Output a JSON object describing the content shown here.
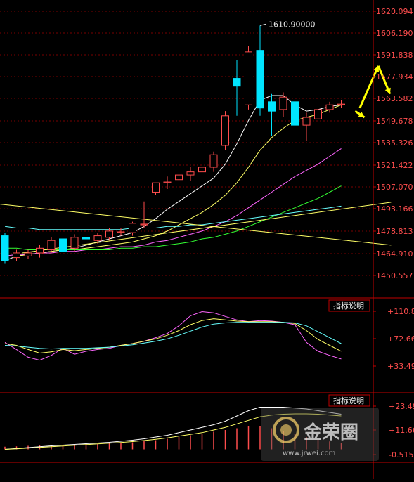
{
  "chart_data": [
    {
      "type": "candlestick",
      "ylim": [
        1442.0,
        1621.0
      ],
      "y_ticks": [
        "1620.094",
        "1606.190",
        "1591.838",
        "1577.934",
        "1563.582",
        "1549.678",
        "1535.326",
        "1521.422",
        "1507.070",
        "1493.166",
        "1478.813",
        "1464.910",
        "1450.557"
      ],
      "peak_label": "1610.90000",
      "peak_value": 1610.9,
      "candles": [
        {
          "o": 1476.0,
          "h": 1478.0,
          "l": 1458.0,
          "c": 1460.0
        },
        {
          "o": 1462.0,
          "h": 1467.0,
          "l": 1460.0,
          "c": 1465.0
        },
        {
          "o": 1463.0,
          "h": 1467.0,
          "l": 1461.0,
          "c": 1465.0
        },
        {
          "o": 1465.0,
          "h": 1470.0,
          "l": 1462.0,
          "c": 1468.0
        },
        {
          "o": 1467.0,
          "h": 1475.0,
          "l": 1465.0,
          "c": 1473.0
        },
        {
          "o": 1474.0,
          "h": 1485.0,
          "l": 1464.0,
          "c": 1466.0
        },
        {
          "o": 1468.0,
          "h": 1477.0,
          "l": 1466.0,
          "c": 1475.0
        },
        {
          "o": 1475.0,
          "h": 1477.0,
          "l": 1472.0,
          "c": 1474.0
        },
        {
          "o": 1473.0,
          "h": 1478.0,
          "l": 1471.0,
          "c": 1476.0
        },
        {
          "o": 1475.0,
          "h": 1481.0,
          "l": 1473.0,
          "c": 1479.0
        },
        {
          "o": 1478.0,
          "h": 1481.0,
          "l": 1476.0,
          "c": 1478.5
        },
        {
          "o": 1478.0,
          "h": 1485.0,
          "l": 1476.0,
          "c": 1484.0
        },
        {
          "o": 1483.0,
          "h": 1498.0,
          "l": 1481.0,
          "c": 1483.5
        },
        {
          "o": 1504.0,
          "h": 1507.0,
          "l": 1502.0,
          "c": 1510.0
        },
        {
          "o": 1510.0,
          "h": 1514.0,
          "l": 1506.0,
          "c": 1510.5
        },
        {
          "o": 1512.0,
          "h": 1517.0,
          "l": 1509.0,
          "c": 1515.0
        },
        {
          "o": 1515.0,
          "h": 1520.0,
          "l": 1511.0,
          "c": 1517.0
        },
        {
          "o": 1517.0,
          "h": 1522.0,
          "l": 1515.0,
          "c": 1520.0
        },
        {
          "o": 1520.0,
          "h": 1530.0,
          "l": 1517.0,
          "c": 1528.0
        },
        {
          "o": 1534.0,
          "h": 1556.0,
          "l": 1531.0,
          "c": 1553.0
        },
        {
          "o": 1577.0,
          "h": 1589.0,
          "l": 1553.0,
          "c": 1572.0
        },
        {
          "o": 1560.0,
          "h": 1598.0,
          "l": 1557.0,
          "c": 1594.0
        },
        {
          "o": 1595.0,
          "h": 1610.9,
          "l": 1553.0,
          "c": 1558.0
        },
        {
          "o": 1562.0,
          "h": 1567.0,
          "l": 1540.0,
          "c": 1556.0
        },
        {
          "o": 1557.0,
          "h": 1568.0,
          "l": 1552.0,
          "c": 1565.0
        },
        {
          "o": 1562.0,
          "h": 1569.0,
          "l": 1547.0,
          "c": 1547.0
        },
        {
          "o": 1547.0,
          "h": 1555.0,
          "l": 1537.0,
          "c": 1552.0
        },
        {
          "o": 1551.0,
          "h": 1559.0,
          "l": 1549.0,
          "c": 1557.0
        },
        {
          "o": 1557.0,
          "h": 1562.0,
          "l": 1555.0,
          "c": 1560.0
        },
        {
          "o": 1560.0,
          "h": 1563.0,
          "l": 1558.0,
          "c": 1560.5
        }
      ],
      "ma_series": [
        {
          "color": "#ffffff",
          "values": [
            1460,
            1463,
            1464,
            1465,
            1466,
            1467,
            1468,
            1470,
            1472,
            1474,
            1476,
            1478,
            1482,
            1487,
            1493,
            1498,
            1503,
            1508,
            1513,
            1522,
            1535,
            1550,
            1563,
            1566,
            1566,
            1560,
            1556,
            1557,
            1559,
            1560
          ]
        },
        {
          "color": "#ffff66",
          "values": [
            1463,
            1463,
            1464,
            1465,
            1466,
            1467,
            1467,
            1468,
            1469,
            1470,
            1471,
            1472,
            1474,
            1476,
            1479,
            1483,
            1487,
            1491,
            1496,
            1502,
            1510,
            1520,
            1531,
            1539,
            1545,
            1550,
            1552,
            1554,
            1557,
            1560
          ]
        },
        {
          "color": "#ff66ff",
          "values": [
            1463,
            1464,
            1464,
            1465,
            1465,
            1466,
            1466,
            1467,
            1467,
            1468,
            1469,
            1469,
            1470,
            1472,
            1473,
            1475,
            1477,
            1479,
            1482,
            1485,
            1489,
            1494,
            1499,
            1504,
            1509,
            1514,
            1518,
            1522,
            1527,
            1532
          ]
        },
        {
          "color": "#33ff33",
          "values": [
            1468,
            1468,
            1467,
            1467,
            1467,
            1467,
            1467,
            1467,
            1467,
            1467,
            1468,
            1468,
            1469,
            1469,
            1470,
            1471,
            1472,
            1474,
            1475,
            1477,
            1479,
            1482,
            1485,
            1488,
            1491,
            1494,
            1497,
            1500,
            1504,
            1508
          ]
        },
        {
          "color": "#66ffff",
          "values": [
            1482,
            1481,
            1481,
            1480,
            1480,
            1480,
            1480,
            1480,
            1480,
            1480,
            1480,
            1481,
            1481,
            1481,
            1482,
            1482,
            1483,
            1483,
            1484,
            1485,
            1486,
            1487,
            1488,
            1489,
            1490,
            1491,
            1492,
            1493,
            1494,
            1495
          ]
        }
      ],
      "trendlines": [
        {
          "color": "#ffff66",
          "from": [
            -0.7,
            1496.5
          ],
          "to": [
            33.3,
            1470.0
          ]
        },
        {
          "color": "#ffff66",
          "from": [
            1.5,
            1465.0
          ],
          "to": [
            33.3,
            1497.5
          ]
        }
      ],
      "projection_arrows": [
        {
          "color": "#ffff00",
          "from": [
            30.6,
            1558.0
          ],
          "to": [
            32.2,
            1585.0
          ]
        },
        {
          "color": "#ffff00",
          "from": [
            32.2,
            1585.0
          ],
          "to": [
            33.2,
            1567.0
          ]
        },
        {
          "color": "#ffff00",
          "from": [
            30.2,
            1556.0
          ],
          "to": [
            31.0,
            1552.0
          ]
        }
      ]
    },
    {
      "type": "line",
      "button_label": "指标说明",
      "ylim": [
        20.0,
        115.0
      ],
      "y_ticks": [
        "+110.8",
        "+72.66",
        "+33.49"
      ],
      "series": [
        {
          "color": "#ff66ff",
          "values": [
            60,
            48,
            35,
            30,
            38,
            50,
            40,
            45,
            48,
            50,
            55,
            58,
            62,
            68,
            75,
            88,
            105,
            112,
            110,
            104,
            98,
            95,
            97,
            96,
            94,
            90,
            60,
            45,
            38,
            32
          ]
        },
        {
          "color": "#ffff66",
          "values": [
            58,
            55,
            48,
            42,
            44,
            48,
            46,
            48,
            50,
            52,
            55,
            58,
            62,
            66,
            72,
            80,
            90,
            97,
            100,
            98,
            96,
            95,
            95,
            95,
            94,
            92,
            80,
            65,
            55,
            45
          ]
        },
        {
          "color": "#66ffff",
          "values": [
            55,
            54,
            52,
            50,
            49,
            50,
            50,
            50,
            51,
            52,
            54,
            56,
            59,
            62,
            66,
            72,
            79,
            86,
            91,
            93,
            94,
            94,
            94,
            94,
            94,
            93,
            88,
            78,
            68,
            58
          ]
        }
      ]
    },
    {
      "type": "bar",
      "button_label": "指标说明",
      "ylim": [
        -3.0,
        25.0
      ],
      "y_ticks": [
        "+23.49",
        "+11.66",
        "-0.515"
      ],
      "histogram": [
        1.5,
        1.7,
        2.0,
        2.2,
        2.4,
        2.6,
        2.8,
        3.0,
        3.2,
        3.4,
        3.6,
        4.0,
        4.6,
        5.2,
        6.0,
        7.0,
        8.0,
        9.0,
        10.0,
        11.0,
        12.0,
        13.0,
        13.0,
        12.0,
        10.5,
        9.0,
        7.0,
        5.5,
        4.5,
        3.5
      ],
      "series": [
        {
          "color": "#ffffff",
          "values": [
            0,
            0.5,
            1,
            1.5,
            2,
            2.4,
            2.8,
            3.2,
            3.6,
            4.0,
            4.6,
            5.2,
            6,
            7,
            8,
            9.5,
            11,
            12.5,
            14,
            16,
            19,
            22,
            24,
            24,
            24,
            23.5,
            23,
            22,
            21,
            20
          ]
        },
        {
          "color": "#ffff66",
          "values": [
            0,
            0.3,
            0.7,
            1.1,
            1.5,
            1.9,
            2.3,
            2.7,
            3.1,
            3.5,
            3.9,
            4.4,
            5,
            5.7,
            6.5,
            7.5,
            8.5,
            9.5,
            11,
            12.5,
            14.5,
            16.5,
            18.5,
            19.5,
            20,
            20.2,
            20.2,
            20,
            19.5,
            19
          ]
        }
      ]
    }
  ],
  "watermark": {
    "brand": "金荣圈",
    "url": "www.jrwei.com"
  },
  "colors": {
    "axis": "#c00000",
    "up": "#ff4d4d",
    "down": "#00e5ff",
    "grid": "#7a0000"
  }
}
